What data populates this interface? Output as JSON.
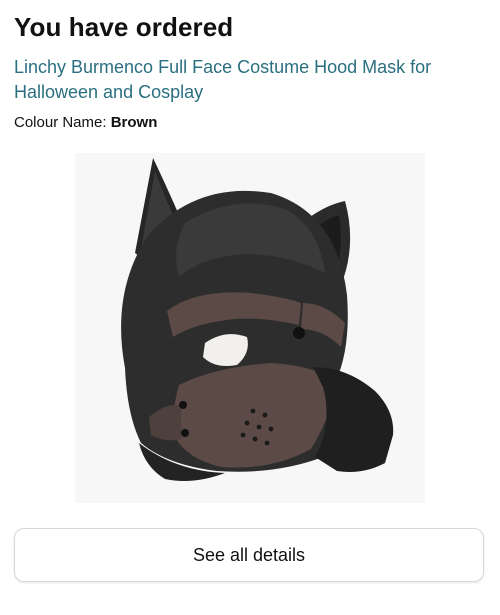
{
  "order": {
    "heading": "You have ordered",
    "product_title": "Linchy Burmenco Full Face Costume Hood Mask for Halloween and Cosplay",
    "colour_label": "Colour Name:",
    "colour_value": "Brown"
  },
  "actions": {
    "see_details_label": "See all details"
  },
  "product_image": {
    "icon": "dog-hood-mask-image",
    "colors": {
      "leather": "#2b2b2b",
      "panel": "#5b4a45",
      "eye": "#f1f0ec"
    }
  }
}
